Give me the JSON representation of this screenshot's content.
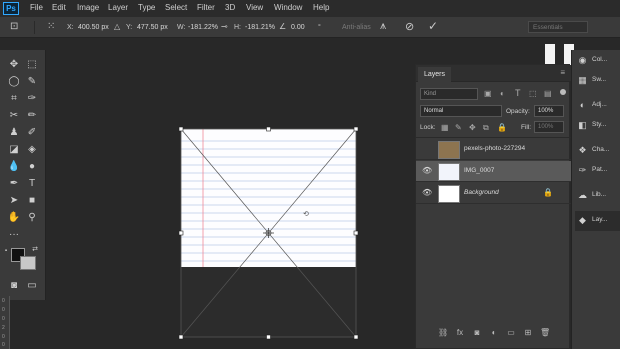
{
  "app": {
    "logo": "Ps"
  },
  "menubar": {
    "items": [
      "File",
      "Edit",
      "Image",
      "Layer",
      "Type",
      "Select",
      "Filter",
      "3D",
      "View",
      "Window",
      "Help"
    ]
  },
  "options": {
    "x_label": "X:",
    "x_value": "400.50 px",
    "y_label": "Y:",
    "y_value": "477.50 px",
    "w_label": "W:",
    "w_value": "-181.22%",
    "h_label": "H:",
    "h_value": "-181.21%",
    "angle_value": "0.00",
    "angle_unit": "°",
    "antialias_label": "Anti-alias",
    "workspace": "Essentials"
  },
  "layers_panel": {
    "tab": "Layers",
    "kind_placeholder": "Kind",
    "blend_mode": "Normal",
    "opacity_label": "Opacity:",
    "opacity_value": "100%",
    "lock_label": "Lock:",
    "fill_label": "Fill:",
    "fill_value": "100%",
    "layers": [
      {
        "name": "pexels-photo-227294",
        "visible": false,
        "selected": false
      },
      {
        "name": "IMG_0007",
        "visible": true,
        "selected": true
      },
      {
        "name": "Background",
        "visible": true,
        "selected": false,
        "locked": true
      }
    ]
  },
  "dock": {
    "items": [
      {
        "label": "Col...",
        "icon": "color-wheel-icon"
      },
      {
        "label": "Sw...",
        "icon": "swatches-icon"
      },
      {
        "label": "Adj...",
        "icon": "adjustments-icon"
      },
      {
        "label": "Sty...",
        "icon": "styles-icon"
      },
      {
        "label": "Cha...",
        "icon": "channels-icon"
      },
      {
        "label": "Pat...",
        "icon": "paths-icon"
      },
      {
        "label": "Lib...",
        "icon": "libraries-icon"
      },
      {
        "label": "Lay...",
        "icon": "layers-icon"
      }
    ]
  },
  "ruler": {
    "marks": [
      "0",
      "0",
      "0",
      "2",
      "0",
      "0"
    ]
  },
  "colors": {
    "accent": "#31a8ff",
    "foreground": "#111111",
    "background": "#c8c8c8"
  }
}
